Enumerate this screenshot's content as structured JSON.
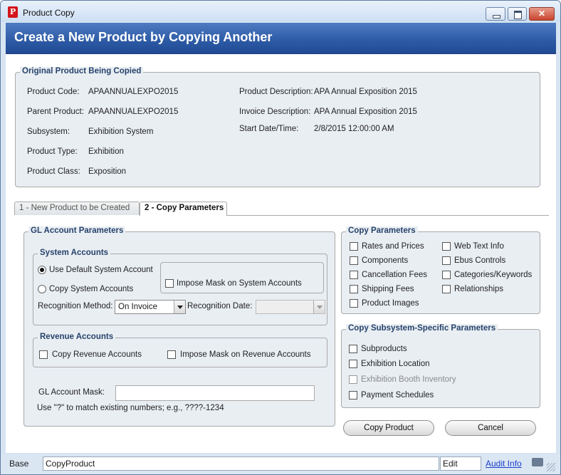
{
  "window": {
    "title": "Product Copy",
    "header": "Create a New Product by Copying Another"
  },
  "original": {
    "legend": "Original Product Being Copied",
    "product_code_label": "Product Code:",
    "product_code": "APAANNUALEXPO2015",
    "parent_product_label": "Parent Product:",
    "parent_product": "APAANNUALEXPO2015",
    "subsystem_label": "Subsystem:",
    "subsystem": "Exhibition System",
    "product_type_label": "Product Type:",
    "product_type": "Exhibition",
    "product_class_label": "Product Class:",
    "product_class": "Exposition",
    "product_description_label": "Product Description:",
    "product_description": "APA Annual Exposition 2015",
    "invoice_description_label": "Invoice Description:",
    "invoice_description": "APA Annual Exposition 2015",
    "start_date_label": "Start Date/Time:",
    "start_date": "2/8/2015 12:00:00 AM"
  },
  "tabs": [
    {
      "label": "1 - New Product to be Created"
    },
    {
      "label": "2 - Copy Parameters"
    }
  ],
  "gl": {
    "legend": "GL Account Parameters",
    "system_accounts_legend": "System Accounts",
    "use_default": "Use Default System Account",
    "copy_system": "Copy System Accounts",
    "impose_mask_system": "Impose Mask on System Accounts",
    "recognition_method_label": "Recognition Method:",
    "recognition_method_value": "On Invoice",
    "recognition_date_label": "Recognition Date:",
    "recognition_date_value": "",
    "revenue_legend": "Revenue Accounts",
    "copy_revenue": "Copy Revenue Accounts",
    "impose_mask_revenue": "Impose Mask on Revenue Accounts",
    "mask_label": "GL Account Mask:",
    "mask_value": "",
    "hint": "Use \"?\" to match existing numbers; e.g., ????-1234"
  },
  "copy_params": {
    "legend": "Copy Parameters",
    "rates": "Rates and Prices",
    "components": "Components",
    "cancellation": "Cancellation Fees",
    "shipping": "Shipping Fees",
    "images": "Product Images",
    "web_text": "Web Text Info",
    "ebus": "Ebus Controls",
    "categories": "Categories/Keywords",
    "relationships": "Relationships"
  },
  "subsystem_params": {
    "legend": "Copy Subsystem-Specific Parameters",
    "subproducts": "Subproducts",
    "location": "Exhibition Location",
    "booth": "Exhibition Booth Inventory",
    "payment": "Payment Schedules"
  },
  "buttons": {
    "copy": "Copy Product",
    "cancel": "Cancel"
  },
  "status": {
    "base": "Base",
    "name": "CopyProduct",
    "mode": "Edit",
    "audit": "Audit Info"
  }
}
